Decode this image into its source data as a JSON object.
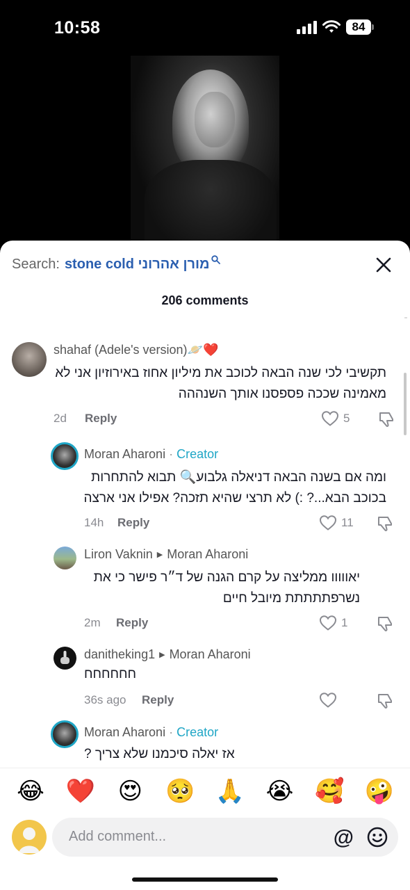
{
  "status_bar": {
    "time": "10:58",
    "battery": "84"
  },
  "search": {
    "label": "Search:",
    "query": "stone cold מורן אהרוני",
    "icon": "search-icon"
  },
  "comments_count": "206 comments",
  "comments": [
    {
      "author": "shahaf (Adele's version)🪐❤️",
      "text_line1": "תקשיבי לכי שנה הבאה לכוכב את מיליון אחוז באירוזיון אני לא",
      "text_line2": "מאמינה שככה פספסנו אותך השנההה",
      "time": "2d",
      "reply": "Reply",
      "likes": "5"
    },
    {
      "author": "Moran Aharoni",
      "separator": "·",
      "badge": "Creator",
      "text_line1": "ומה אם בשנה הבאה דניאלה גלבוע🔍 תבוא להתחרות",
      "text_line2": "בכוכב הבא...? :) לא תרצי שהיא תזכה? אפילו אני ארצה",
      "time": "14h",
      "reply": "Reply",
      "likes": "11"
    },
    {
      "author": "Liron Vaknin",
      "reply_to": "Moran Aharoni",
      "text_line1": "יאווווו ממליצה על קרם הגנה של ד״ר פישר כי את",
      "text_line2": "נשרפתתתתת מיובל חיים",
      "time": "2m",
      "reply": "Reply",
      "likes": "1"
    },
    {
      "author": "danitheking1",
      "reply_to": "Moran Aharoni",
      "text_line1": "חחחחחח",
      "time": "36s ago",
      "reply": "Reply",
      "likes": ""
    },
    {
      "author": "Moran Aharoni",
      "separator": "·",
      "badge": "Creator",
      "text_line1": "אז יאלה סיכמנו שלא צריך ?"
    }
  ],
  "emojis": [
    "😂",
    "❤️",
    "😍",
    "🥺",
    "🙏",
    "😭",
    "🥰",
    "🤪"
  ],
  "input": {
    "placeholder": "Add comment...",
    "mention_symbol": "@"
  },
  "colors": {
    "creator": "#1fa6c6",
    "search_query": "#2b5fb0",
    "text": "#161823",
    "muted": "#8a8b91"
  }
}
